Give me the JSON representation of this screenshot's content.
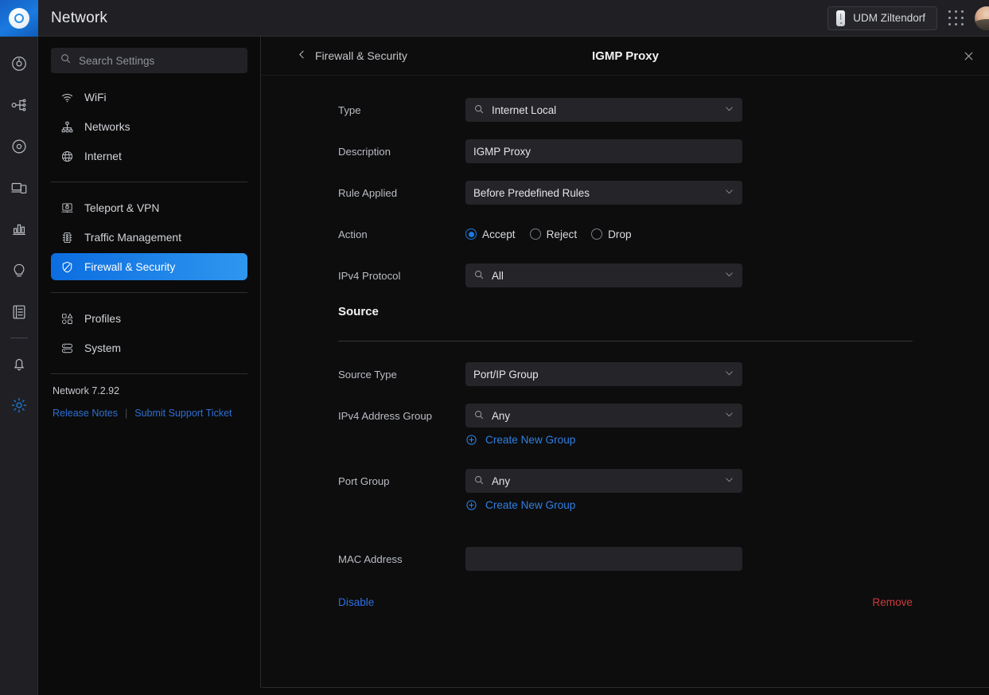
{
  "app": {
    "title": "Network",
    "logo_icon": "unifi-logo-icon"
  },
  "rail": {
    "items": [
      {
        "icon": "dashboard-speedometer-icon",
        "name": "dashboard"
      },
      {
        "icon": "topology-icon",
        "name": "topology"
      },
      {
        "icon": "unifi-devices-circle-icon",
        "name": "devices"
      },
      {
        "icon": "client-devices-icon",
        "name": "clients"
      },
      {
        "icon": "statistics-bar-chart-icon",
        "name": "statistics"
      },
      {
        "icon": "insights-lightbulb-icon",
        "name": "insights"
      },
      {
        "icon": "logs-notebook-icon",
        "name": "logs"
      },
      {
        "icon": "bell-notification-icon",
        "name": "notifications"
      },
      {
        "icon": "gear-settings-icon",
        "name": "settings"
      }
    ]
  },
  "topbar": {
    "device_name": "UDM Ziltendorf",
    "device_icon": "udm-device-icon",
    "apps_icon": "apps-grid-icon",
    "avatar_icon": "user-avatar"
  },
  "sidebar": {
    "search": {
      "placeholder": "Search Settings",
      "value": "",
      "icon": "search-icon"
    },
    "groups": [
      {
        "items": [
          {
            "label": "WiFi",
            "icon": "wifi-icon",
            "active": false
          },
          {
            "label": "Networks",
            "icon": "networks-hierarchy-icon",
            "active": false
          },
          {
            "label": "Internet",
            "icon": "globe-icon",
            "active": false
          }
        ]
      },
      {
        "items": [
          {
            "label": "Teleport & VPN",
            "icon": "teleport-vpn-lock-icon",
            "active": false
          },
          {
            "label": "Traffic Management",
            "icon": "traffic-light-icon",
            "active": false
          },
          {
            "label": "Firewall & Security",
            "icon": "shield-icon",
            "active": true
          }
        ]
      },
      {
        "items": [
          {
            "label": "Profiles",
            "icon": "profiles-shapes-icon",
            "active": false
          },
          {
            "label": "System",
            "icon": "system-server-icon",
            "active": false
          }
        ]
      }
    ],
    "footer": {
      "version": "Network 7.2.92",
      "release_notes": "Release Notes",
      "separator": "|",
      "support_ticket": "Submit Support Ticket"
    }
  },
  "panel": {
    "back_label": "Firewall & Security",
    "back_icon": "chevron-left-icon",
    "title": "IGMP Proxy",
    "close_icon": "close-icon",
    "fields": {
      "type": {
        "label": "Type",
        "value": "Internet Local",
        "icon": "search-icon",
        "caret": "chevron-down-icon"
      },
      "description": {
        "label": "Description",
        "value": "IGMP Proxy",
        "placeholder": ""
      },
      "rule_applied": {
        "label": "Rule Applied",
        "value": "Before Predefined Rules",
        "caret": "chevron-down-icon"
      },
      "action": {
        "label": "Action",
        "options": [
          {
            "label": "Accept",
            "selected": true
          },
          {
            "label": "Reject",
            "selected": false
          },
          {
            "label": "Drop",
            "selected": false
          }
        ]
      },
      "ipv4_protocol": {
        "label": "IPv4 Protocol",
        "value": "All",
        "icon": "search-icon",
        "caret": "chevron-down-icon"
      }
    },
    "source": {
      "heading": "Source",
      "source_type": {
        "label": "Source Type",
        "value": "Port/IP Group",
        "caret": "chevron-down-icon"
      },
      "ipv4_address_group": {
        "label": "IPv4 Address Group",
        "value": "Any",
        "icon": "search-icon",
        "caret": "chevron-down-icon",
        "create_link": "Create New Group",
        "create_icon": "plus-circle-icon"
      },
      "port_group": {
        "label": "Port Group",
        "value": "Any",
        "icon": "search-icon",
        "caret": "chevron-down-icon",
        "create_link": "Create New Group",
        "create_icon": "plus-circle-icon"
      },
      "mac_address": {
        "label": "MAC Address",
        "value": "",
        "placeholder": ""
      }
    },
    "actions": {
      "disable": "Disable",
      "remove": "Remove"
    }
  },
  "colors": {
    "accent_blue": "#1a7ae0",
    "link_blue": "#2f7fe0",
    "danger_red": "#cf3b3b",
    "panel_bg": "#0d0d0e",
    "rail_bg": "#202024",
    "field_bg": "#252529"
  }
}
